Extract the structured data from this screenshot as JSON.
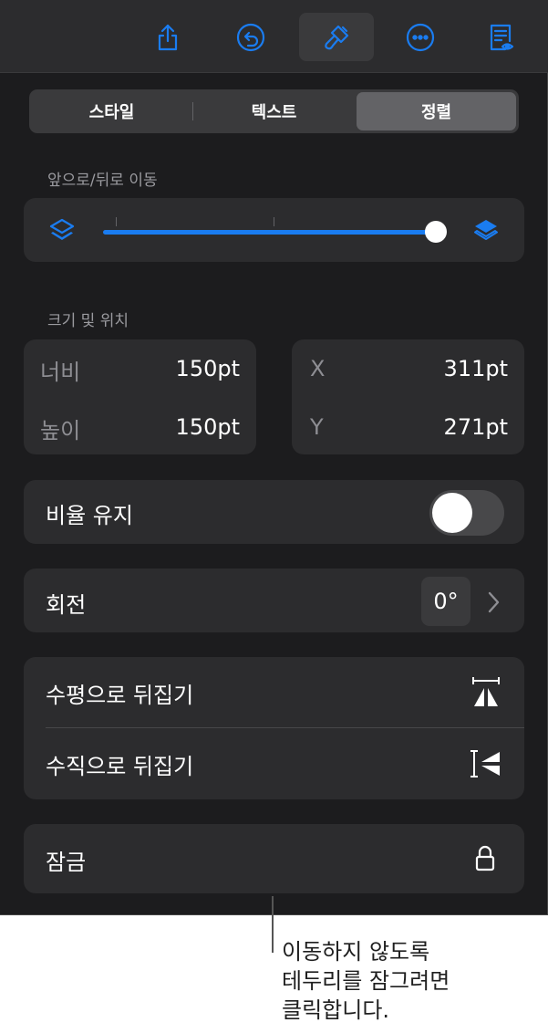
{
  "toolbar": {
    "items": [
      "share-icon",
      "undo-icon",
      "format-brush-icon",
      "more-icon",
      "reading-view-icon"
    ],
    "active": "format-brush-icon",
    "accent": "#1a7cf0"
  },
  "tabs": {
    "style": "스타일",
    "text": "텍스트",
    "arrange": "정렬",
    "selected": "정렬"
  },
  "move": {
    "label": "앞으로/뒤로 이동",
    "slider_value": 1.0,
    "left_icon": "send-backward-layers-icon",
    "right_icon": "bring-forward-layers-icon"
  },
  "size_position": {
    "label": "크기 및 위치",
    "width_label": "너비",
    "width_value": "150pt",
    "height_label": "높이",
    "height_value": "150pt",
    "x_label": "X",
    "x_value": "311pt",
    "y_label": "Y",
    "y_value": "271pt"
  },
  "constrain": {
    "label": "비율 유지",
    "on": false
  },
  "rotate": {
    "label": "회전",
    "value": "0°"
  },
  "flip": {
    "horizontal": "수평으로 뒤집기",
    "vertical": "수직으로 뒤집기"
  },
  "lock": {
    "label": "잠금",
    "icon": "lock-icon"
  },
  "callout": "이동하지 않도록\n테두리를 잠그려면\n클릭합니다."
}
